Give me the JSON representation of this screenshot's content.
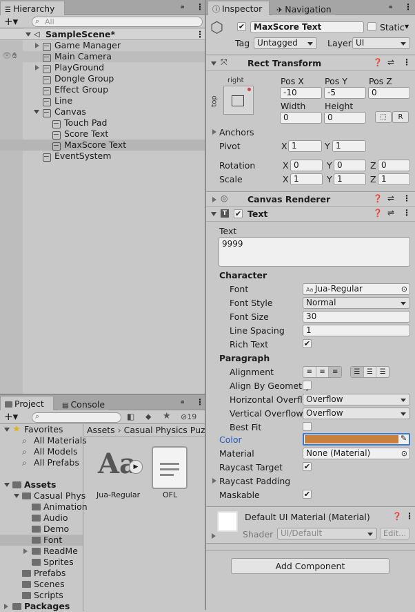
{
  "hierarchy": {
    "tab": "Hierarchy",
    "search_placeholder": "All",
    "scene": "SampleScene*",
    "items": [
      {
        "label": "Game Manager",
        "indent": 2,
        "arrow": "right"
      },
      {
        "label": "Main Camera",
        "indent": 2,
        "arrow": ""
      },
      {
        "label": "PlayGround",
        "indent": 2,
        "arrow": "right"
      },
      {
        "label": "Dongle Group",
        "indent": 2,
        "arrow": ""
      },
      {
        "label": "Effect Group",
        "indent": 2,
        "arrow": ""
      },
      {
        "label": "Line",
        "indent": 2,
        "arrow": ""
      },
      {
        "label": "Canvas",
        "indent": 2,
        "arrow": "down"
      },
      {
        "label": "Touch Pad",
        "indent": 3,
        "arrow": ""
      },
      {
        "label": "Score Text",
        "indent": 3,
        "arrow": ""
      },
      {
        "label": "MaxScore Text",
        "indent": 3,
        "arrow": "",
        "selected": true
      },
      {
        "label": "EventSystem",
        "indent": 2,
        "arrow": ""
      }
    ]
  },
  "project": {
    "tab": "Project",
    "tab2": "Console",
    "hidden_count": "19",
    "tree": [
      {
        "label": "Favorites",
        "type": "fav",
        "indent": 0,
        "arrow": "down"
      },
      {
        "label": "All Materials",
        "type": "search",
        "indent": 1
      },
      {
        "label": "All Models",
        "type": "search",
        "indent": 1
      },
      {
        "label": "All Prefabs",
        "type": "search",
        "indent": 1
      },
      {
        "label": "",
        "type": "gap",
        "indent": 0
      },
      {
        "label": "Assets",
        "type": "folder",
        "indent": 0,
        "arrow": "down",
        "bold": true
      },
      {
        "label": "Casual Phys",
        "type": "folder",
        "indent": 1,
        "arrow": "down"
      },
      {
        "label": "Animation",
        "type": "folder",
        "indent": 2
      },
      {
        "label": "Audio",
        "type": "folder",
        "indent": 2
      },
      {
        "label": "Demo",
        "type": "folder",
        "indent": 2
      },
      {
        "label": "Font",
        "type": "folder",
        "indent": 2,
        "selected": true
      },
      {
        "label": "ReadMe",
        "type": "folder",
        "indent": 2,
        "arrow": "right"
      },
      {
        "label": "Sprites",
        "type": "folder",
        "indent": 2
      },
      {
        "label": "Prefabs",
        "type": "folder",
        "indent": 1
      },
      {
        "label": "Scenes",
        "type": "folder",
        "indent": 1
      },
      {
        "label": "Scripts",
        "type": "folder",
        "indent": 1
      },
      {
        "label": "Packages",
        "type": "folder",
        "indent": 0,
        "arrow": "right",
        "bold": true
      }
    ],
    "breadcrumb": [
      "Assets",
      "Casual Physics Puzz"
    ],
    "assets": [
      {
        "label": "Jua-Regular",
        "glyph": "Aa"
      },
      {
        "label": "OFL",
        "glyph": ""
      }
    ]
  },
  "inspector": {
    "tab": "Inspector",
    "tab2": "Navigation",
    "name": "MaxScore Text",
    "static": "Static",
    "tag_label": "Tag",
    "tag": "Untagged",
    "layer_label": "Layer",
    "layer": "UI",
    "rect": {
      "title": "Rect Transform",
      "anchor_h": "right",
      "anchor_v": "top",
      "posx_l": "Pos X",
      "posy_l": "Pos Y",
      "posz_l": "Pos Z",
      "posx": "-10",
      "posy": "-5",
      "posz": "0",
      "w_l": "Width",
      "h_l": "Height",
      "w": "0",
      "h": "0",
      "r_btn": "R",
      "anchors": "Anchors",
      "pivot": "Pivot",
      "pivot_x": "1",
      "pivot_y": "1",
      "rotation": "Rotation",
      "rot_x": "0",
      "rot_y": "0",
      "rot_z": "0",
      "scale": "Scale",
      "sc_x": "1",
      "sc_y": "1",
      "sc_z": "1",
      "x": "X",
      "y": "Y",
      "z": "Z"
    },
    "canvas_renderer": "Canvas Renderer",
    "text": {
      "title": "Text",
      "text_label": "Text",
      "value": "9999",
      "character": "Character",
      "font_l": "Font",
      "font": "Jua-Regular",
      "font_style_l": "Font Style",
      "font_style": "Normal",
      "font_size_l": "Font Size",
      "font_size": "30",
      "line_spacing_l": "Line Spacing",
      "line_spacing": "1",
      "rich_text_l": "Rich Text",
      "paragraph": "Paragraph",
      "alignment_l": "Alignment",
      "align_geom_l": "Align By Geometry",
      "h_overflow_l": "Horizontal Overflow",
      "h_overflow": "Overflow",
      "v_overflow_l": "Vertical Overflow",
      "v_overflow": "Overflow",
      "best_fit_l": "Best Fit",
      "color_l": "Color",
      "color": "#c8803f",
      "material_l": "Material",
      "material": "None (Material)",
      "raycast_l": "Raycast Target",
      "raycast_pad_l": "Raycast Padding",
      "maskable_l": "Maskable"
    },
    "material": {
      "name": "Default UI Material (Material)",
      "shader_l": "Shader",
      "shader": "UI/Default",
      "edit": "Edit..."
    },
    "add_component": "Add Component"
  }
}
